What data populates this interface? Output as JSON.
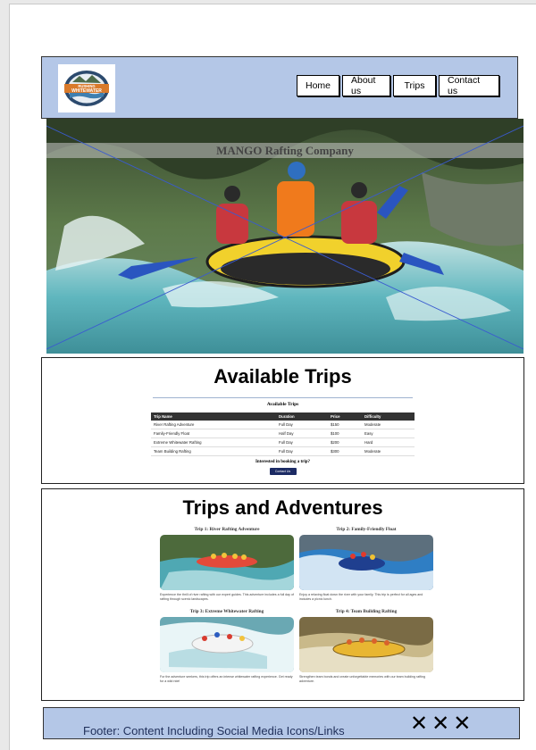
{
  "header": {
    "logo": {
      "line1": "RUSHING",
      "line2": "WHITEWATER"
    },
    "nav": [
      {
        "label": "Home"
      },
      {
        "label": "About us"
      },
      {
        "label": "Trips"
      },
      {
        "label": "Contact us"
      }
    ]
  },
  "hero": {
    "title": "MANGO Rafting Company"
  },
  "available_trips": {
    "title": "Available Trips",
    "mock": {
      "heading": "Available Trips",
      "columns": [
        "Trip Name",
        "Duration",
        "Price",
        "Difficulty"
      ],
      "rows": [
        [
          "River Rafting Adventure",
          "Full Day",
          "$150",
          "Moderate"
        ],
        [
          "Family-Friendly Float",
          "Half Day",
          "$100",
          "Easy"
        ],
        [
          "Extreme Whitewater Rafting",
          "Full Day",
          "$200",
          "Hard"
        ],
        [
          "Team Building Rafting",
          "Full Day",
          "$300",
          "Moderate"
        ]
      ],
      "question": "Interested in booking a trip?",
      "button": "Contact Us"
    }
  },
  "adventures": {
    "title": "Trips and Adventures",
    "cards": [
      {
        "title": "Trip 1: River Rafting Adventure",
        "desc": "Experience the thrill of river rafting with our expert guides. This adventure includes a full day of rafting through scenic landscapes."
      },
      {
        "title": "Trip 2: Family-Friendly Float",
        "desc": "Enjoy a relaxing float down the river with your family. This trip is perfect for all ages and includes a picnic lunch."
      },
      {
        "title": "Trip 3: Extreme Whitewater Rafting",
        "desc": "For the adventure seekers, this trip offers an intense whitewater rafting experience. Get ready for a wild ride!"
      },
      {
        "title": "Trip 4: Team Building Rafting",
        "desc": "Strengthen team bonds and create unforgettable memories with our team building rafting adventure."
      }
    ]
  },
  "footer": {
    "text": "Footer: Content Including Social Media Icons/Links",
    "icons": [
      "✕",
      "✕",
      "✕"
    ]
  }
}
